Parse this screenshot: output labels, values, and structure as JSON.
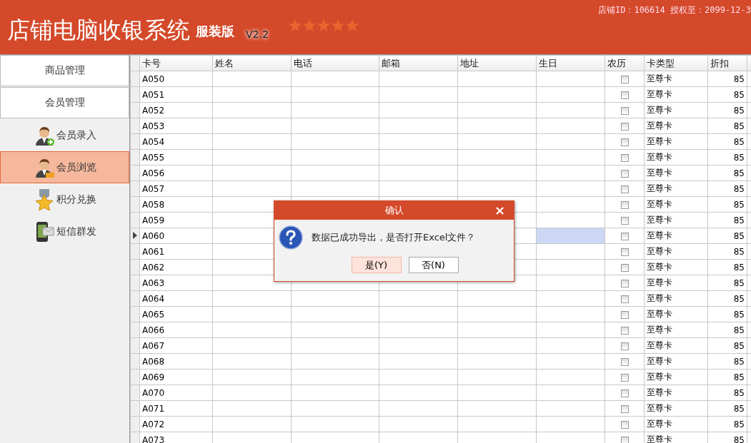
{
  "header": {
    "title": "店铺电脑收银系统",
    "edition": "服装版",
    "version": "V2.2",
    "shop_info": "店铺ID：106614 授权至：2099-12-3"
  },
  "sidebar": {
    "sections": [
      {
        "label": "商品管理"
      },
      {
        "label": "会员管理"
      }
    ],
    "items": [
      {
        "label": "会员录入",
        "selected": false
      },
      {
        "label": "会员浏览",
        "selected": true
      },
      {
        "label": "积分兑换",
        "selected": false
      },
      {
        "label": "短信群发",
        "selected": false
      }
    ]
  },
  "table": {
    "columns": [
      {
        "label": "卡号",
        "kind": "card_no"
      },
      {
        "label": "姓名",
        "kind": "name"
      },
      {
        "label": "电话",
        "kind": "phone"
      },
      {
        "label": "邮箱",
        "kind": "email"
      },
      {
        "label": "地址",
        "kind": "address"
      },
      {
        "label": "生日",
        "kind": "birthday",
        "focused": true
      },
      {
        "label": "农历",
        "kind": "lunar"
      },
      {
        "label": "卡类型",
        "kind": "card_type"
      },
      {
        "label": "折扣",
        "kind": "discount"
      },
      {
        "kind": "cut"
      }
    ],
    "rows": [
      {
        "card_no": "A050",
        "lunar": false,
        "card_type": "至尊卡",
        "discount": "85",
        "selected": false
      },
      {
        "card_no": "A051",
        "lunar": false,
        "card_type": "至尊卡",
        "discount": "85",
        "selected": false
      },
      {
        "card_no": "A052",
        "lunar": false,
        "card_type": "至尊卡",
        "discount": "85",
        "selected": false
      },
      {
        "card_no": "A053",
        "lunar": false,
        "card_type": "至尊卡",
        "discount": "85",
        "selected": false
      },
      {
        "card_no": "A054",
        "lunar": false,
        "card_type": "至尊卡",
        "discount": "85",
        "selected": false
      },
      {
        "card_no": "A055",
        "lunar": false,
        "card_type": "至尊卡",
        "discount": "85",
        "selected": false
      },
      {
        "card_no": "A056",
        "lunar": false,
        "card_type": "至尊卡",
        "discount": "85",
        "selected": false
      },
      {
        "card_no": "A057",
        "lunar": false,
        "card_type": "至尊卡",
        "discount": "85",
        "selected": false
      },
      {
        "card_no": "A058",
        "lunar": false,
        "card_type": "至尊卡",
        "discount": "85",
        "selected": false
      },
      {
        "card_no": "A059",
        "lunar": false,
        "card_type": "至尊卡",
        "discount": "85",
        "selected": false
      },
      {
        "card_no": "A060",
        "lunar": false,
        "card_type": "至尊卡",
        "discount": "85",
        "selected": true
      },
      {
        "card_no": "A061",
        "lunar": false,
        "card_type": "至尊卡",
        "discount": "85",
        "selected": false
      },
      {
        "card_no": "A062",
        "lunar": false,
        "card_type": "至尊卡",
        "discount": "85",
        "selected": false
      },
      {
        "card_no": "A063",
        "lunar": false,
        "card_type": "至尊卡",
        "discount": "85",
        "selected": false
      },
      {
        "card_no": "A064",
        "lunar": false,
        "card_type": "至尊卡",
        "discount": "85",
        "selected": false
      },
      {
        "card_no": "A065",
        "lunar": false,
        "card_type": "至尊卡",
        "discount": "85",
        "selected": false
      },
      {
        "card_no": "A066",
        "lunar": false,
        "card_type": "至尊卡",
        "discount": "85",
        "selected": false
      },
      {
        "card_no": "A067",
        "lunar": false,
        "card_type": "至尊卡",
        "discount": "85",
        "selected": false
      },
      {
        "card_no": "A068",
        "lunar": false,
        "card_type": "至尊卡",
        "discount": "85",
        "selected": false
      },
      {
        "card_no": "A069",
        "lunar": false,
        "card_type": "至尊卡",
        "discount": "85",
        "selected": false
      },
      {
        "card_no": "A070",
        "lunar": false,
        "card_type": "至尊卡",
        "discount": "85",
        "selected": false
      },
      {
        "card_no": "A071",
        "lunar": false,
        "card_type": "至尊卡",
        "discount": "85",
        "selected": false
      },
      {
        "card_no": "A072",
        "lunar": false,
        "card_type": "至尊卡",
        "discount": "85",
        "selected": false
      },
      {
        "card_no": "A073",
        "lunar": false,
        "card_type": "至尊卡",
        "discount": "85",
        "selected": false
      }
    ]
  },
  "dialog": {
    "title": "确认",
    "close": "×",
    "message": "数据已成功导出，是否打开Excel文件？",
    "buttons": [
      {
        "label": "是(Y)",
        "selected": true
      },
      {
        "label": "否(N)",
        "selected": false
      }
    ]
  }
}
